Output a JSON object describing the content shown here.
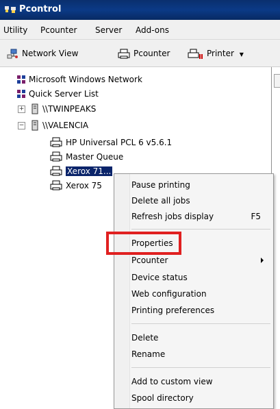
{
  "window": {
    "title": "Pcontrol",
    "icon": "pcontrol-app-icon"
  },
  "menubar": {
    "items": [
      {
        "label": "Utility"
      },
      {
        "label": "Pcounter"
      },
      {
        "label": "Server"
      },
      {
        "label": "Add-ons"
      }
    ]
  },
  "toolbar": {
    "network_view": {
      "label": "Network View",
      "icon": "network-icon"
    },
    "pcounter": {
      "label": "Pcounter",
      "icon": "printer-icon"
    },
    "printer": {
      "label": "Printer",
      "icon": "printer-red-icon"
    }
  },
  "tree": {
    "microsoft_windows_network": "Microsoft Windows Network",
    "quick_server_list": "Quick Server List",
    "twinpeaks": "\\\\TWINPEAKS",
    "valencia": "\\\\VALENCIA",
    "printers": [
      {
        "label": "HP Universal PCL 6 v5.6.1"
      },
      {
        "label": "Master Queue"
      },
      {
        "label": "Xerox 71..."
      },
      {
        "label": "Xerox 75"
      }
    ]
  },
  "context_menu": {
    "groups": [
      [
        {
          "label": "Pause printing"
        },
        {
          "label": "Delete all jobs"
        },
        {
          "label": "Refresh jobs display",
          "shortcut": "F5"
        }
      ],
      [
        {
          "label": "Properties"
        },
        {
          "label": "Pcounter"
        },
        {
          "label": "Device status"
        },
        {
          "label": "Web configuration"
        },
        {
          "label": "Printing preferences"
        }
      ],
      [
        {
          "label": "Delete"
        },
        {
          "label": "Rename"
        }
      ],
      [
        {
          "label": "Add to custom view"
        },
        {
          "label": "Spool directory"
        }
      ]
    ]
  },
  "colors": {
    "title_bar": "#0b3a86",
    "selection": "#0a246a",
    "highlight_box": "#e02020"
  }
}
